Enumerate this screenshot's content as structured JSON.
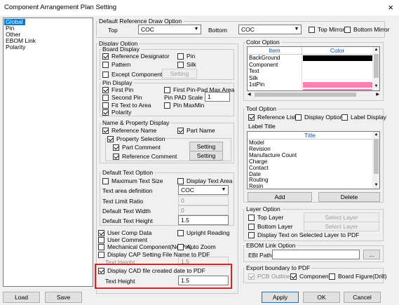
{
  "window": {
    "title": "Component Arrangement Plan Setting",
    "close": "×"
  },
  "nav": {
    "items": [
      "Global",
      "Pin",
      "Other",
      "EBOM Link",
      "Polarity"
    ]
  },
  "draw_option": {
    "title": "Default Reference Draw Option",
    "top_label": "Top",
    "top_value": "COC",
    "bottom_label": "Bottom",
    "bottom_value": "COC",
    "top_mirror": "Top Mirror",
    "bottom_mirror": "Bottom Mirror"
  },
  "display_option": {
    "title": "Display Option"
  },
  "board_display": {
    "title": "Board Display",
    "reference_designator": "Reference Designator",
    "pin": "Pin",
    "pattern": "Pattern",
    "silk": "Silk",
    "except_component": "Except Component",
    "setting": "Setting"
  },
  "pin_display": {
    "title": "Pin Display",
    "first_pin": "First Pin",
    "first_pin_pad_max_area": "First Pin-Pad Max Area",
    "second_pin": "Second Pin",
    "pin_pad_scale": "Pin PAD Scale",
    "pin_pad_scale_value": "1",
    "fit_text_to_area": "Fit Text to Area",
    "pin_maxmin": "Pin MaxMin",
    "polarity": "Polarity"
  },
  "name_property": {
    "title": "Name & Property Display",
    "reference_name": "Reference Name",
    "part_name": "Part Name",
    "property_selection": "Property Selection",
    "part_comment": "Part Comment",
    "reference_comment": "Reference Comment",
    "setting1": "Setting",
    "setting2": "Setting"
  },
  "default_text": {
    "title": "Default Text Option",
    "maximum_text_size": "Maximum Text Size",
    "display_text_area": "Display Text Area",
    "text_area_definition": "Text area definition",
    "text_area_value": "COC",
    "text_limit_ratio": "Text Limit Ratio",
    "text_limit_value": "0",
    "default_text_width": "Default Text Width",
    "default_text_width_value": "0",
    "default_text_height": "Default Text Height",
    "default_text_height_value": "1.5"
  },
  "misc": {
    "user_comp_data": "User Comp Data",
    "upright_reading": "Upright Reading",
    "user_comment": "User Comment",
    "mechanical_component": "Mechanical Component(No Pin)",
    "auto_zoom": "Auto Zoom",
    "display_cap_setting": "Display CAP Setting File Name to PDF",
    "text_height_label1": "Text Height",
    "text_height_value1": "1.5",
    "display_cad_file": "Display CAD file created date to PDF",
    "text_height_label2": "Text Height",
    "text_height_value2": "1.5"
  },
  "color_option": {
    "title": "Color Option",
    "col_item": "Item",
    "col_color": "Color",
    "rows": [
      {
        "item": "BackGround",
        "color": "#000000"
      },
      {
        "item": "Component",
        "color": "#ffffff"
      },
      {
        "item": "Text",
        "color": "#ffffff"
      },
      {
        "item": "Silk",
        "color": "#ffffff"
      },
      {
        "item": "1stPin",
        "color": "#ff7eb4"
      },
      {
        "item": "",
        "color": "#ff7eb4"
      }
    ]
  },
  "tool_option": {
    "title": "Tool Option",
    "reference_list": "Reference List",
    "display_option": "Display Option",
    "label_display": "Label Display",
    "label_title": "Label Title",
    "col_title": "Title",
    "items": [
      "Model",
      "Revision",
      "Manufacture Count",
      "Charge",
      "Contact",
      "Date",
      "Routing",
      "Resin"
    ],
    "add": "Add",
    "delete": "Delete"
  },
  "layer_option": {
    "title": "Layer Option",
    "top_layer": "Top Layer",
    "select_layer_top": "Select Layer",
    "bottom_layer": "Bottom Layer",
    "select_layer_bottom": "Select Layer",
    "display_text_selected": "Display Text on Selected Layer to PDF"
  },
  "ebom": {
    "title": "EBOM Link Option",
    "ebi_path": "EBI Path",
    "browse": "..."
  },
  "export": {
    "title": "Export boundary to PDF",
    "pcb_outline": "PCB Outline",
    "component": "Component",
    "board_figure": "Board Figure(Drill)"
  },
  "footer": {
    "load": "Load",
    "save": "Save",
    "apply": "Apply",
    "ok": "OK",
    "cancel": "Cancel"
  },
  "colors": {
    "accent": "#0078d7",
    "highlight": "#e02020",
    "pink": "#ff7eb4"
  }
}
